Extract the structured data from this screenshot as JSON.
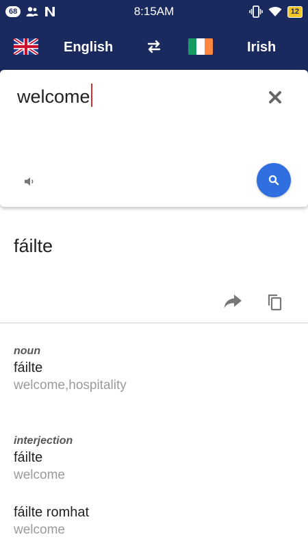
{
  "status_bar": {
    "notification_count": "68",
    "time": "8:15AM",
    "battery": "12"
  },
  "header": {
    "source_language": "English",
    "target_language": "Irish"
  },
  "input": {
    "text": "welcome"
  },
  "result": {
    "translation": "fáilte"
  },
  "dictionary": [
    {
      "pos": "noun",
      "word": "fáilte",
      "gloss": "welcome,hospitality"
    },
    {
      "pos": "interjection",
      "word": "fáilte",
      "gloss": "welcome"
    },
    {
      "pos": "",
      "word": "fáilte romhat",
      "gloss": "welcome"
    }
  ],
  "colors": {
    "header_bg": "#1b2a5e",
    "accent_button": "#2f6fe0",
    "caret": "#d32f2f"
  }
}
